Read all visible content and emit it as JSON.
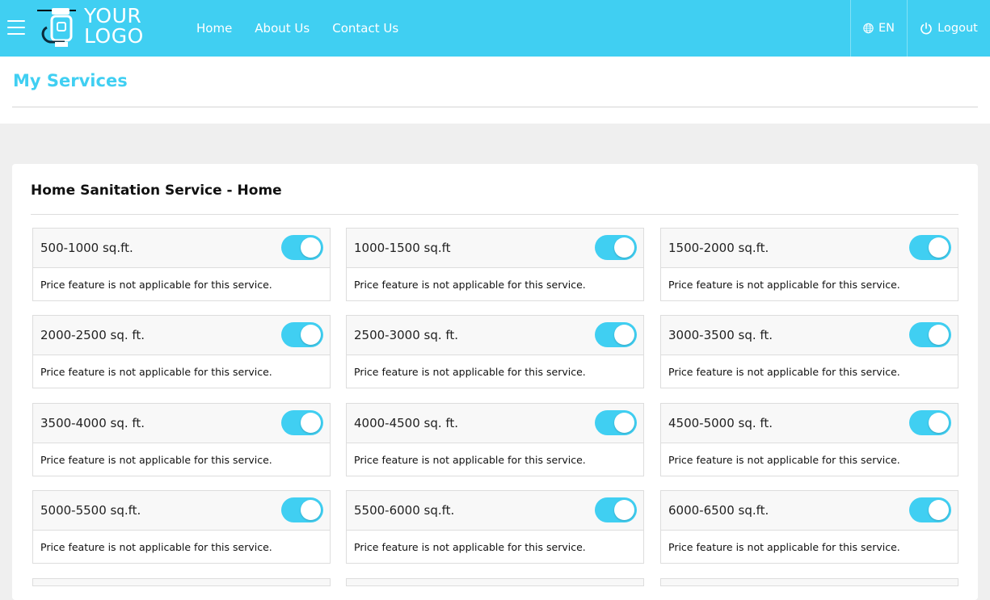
{
  "header": {
    "logo_line1": "YOUR",
    "logo_line2": "LOGO",
    "nav": [
      "Home",
      "About Us",
      "Contact Us"
    ],
    "language": "EN",
    "logout": "Logout"
  },
  "page": {
    "title": "My Services"
  },
  "section": {
    "title": "Home Sanitation Service - Home",
    "services": [
      {
        "name": "500-1000 sq.ft.",
        "note": "Price feature is not applicable for this service.",
        "enabled": true
      },
      {
        "name": "1000-1500 sq.ft",
        "note": "Price feature is not applicable for this service.",
        "enabled": true
      },
      {
        "name": "1500-2000 sq.ft.",
        "note": "Price feature is not applicable for this service.",
        "enabled": true
      },
      {
        "name": "2000-2500 sq. ft.",
        "note": "Price feature is not applicable for this service.",
        "enabled": true
      },
      {
        "name": "2500-3000 sq. ft.",
        "note": "Price feature is not applicable for this service.",
        "enabled": true
      },
      {
        "name": "3000-3500 sq. ft.",
        "note": "Price feature is not applicable for this service.",
        "enabled": true
      },
      {
        "name": "3500-4000 sq. ft.",
        "note": "Price feature is not applicable for this service.",
        "enabled": true
      },
      {
        "name": "4000-4500 sq. ft.",
        "note": "Price feature is not applicable for this service.",
        "enabled": true
      },
      {
        "name": "4500-5000 sq. ft.",
        "note": "Price feature is not applicable for this service.",
        "enabled": true
      },
      {
        "name": "5000-5500 sq.ft.",
        "note": "Price feature is not applicable for this service.",
        "enabled": true
      },
      {
        "name": "5500-6000 sq.ft.",
        "note": "Price feature is not applicable for this service.",
        "enabled": true
      },
      {
        "name": "6000-6500 sq.ft.",
        "note": "Price feature is not applicable for this service.",
        "enabled": true
      }
    ]
  },
  "colors": {
    "brand": "#40cff2",
    "page_bg": "#efefef"
  }
}
